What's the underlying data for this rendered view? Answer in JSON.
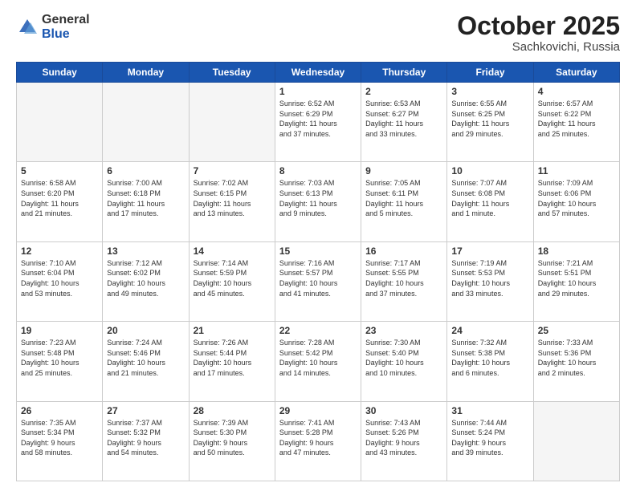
{
  "header": {
    "logo_general": "General",
    "logo_blue": "Blue",
    "month_title": "October 2025",
    "location": "Sachkovichi, Russia"
  },
  "days_of_week": [
    "Sunday",
    "Monday",
    "Tuesday",
    "Wednesday",
    "Thursday",
    "Friday",
    "Saturday"
  ],
  "weeks": [
    [
      {
        "day": "",
        "info": ""
      },
      {
        "day": "",
        "info": ""
      },
      {
        "day": "",
        "info": ""
      },
      {
        "day": "1",
        "info": "Sunrise: 6:52 AM\nSunset: 6:29 PM\nDaylight: 11 hours\nand 37 minutes."
      },
      {
        "day": "2",
        "info": "Sunrise: 6:53 AM\nSunset: 6:27 PM\nDaylight: 11 hours\nand 33 minutes."
      },
      {
        "day": "3",
        "info": "Sunrise: 6:55 AM\nSunset: 6:25 PM\nDaylight: 11 hours\nand 29 minutes."
      },
      {
        "day": "4",
        "info": "Sunrise: 6:57 AM\nSunset: 6:22 PM\nDaylight: 11 hours\nand 25 minutes."
      }
    ],
    [
      {
        "day": "5",
        "info": "Sunrise: 6:58 AM\nSunset: 6:20 PM\nDaylight: 11 hours\nand 21 minutes."
      },
      {
        "day": "6",
        "info": "Sunrise: 7:00 AM\nSunset: 6:18 PM\nDaylight: 11 hours\nand 17 minutes."
      },
      {
        "day": "7",
        "info": "Sunrise: 7:02 AM\nSunset: 6:15 PM\nDaylight: 11 hours\nand 13 minutes."
      },
      {
        "day": "8",
        "info": "Sunrise: 7:03 AM\nSunset: 6:13 PM\nDaylight: 11 hours\nand 9 minutes."
      },
      {
        "day": "9",
        "info": "Sunrise: 7:05 AM\nSunset: 6:11 PM\nDaylight: 11 hours\nand 5 minutes."
      },
      {
        "day": "10",
        "info": "Sunrise: 7:07 AM\nSunset: 6:08 PM\nDaylight: 11 hours\nand 1 minute."
      },
      {
        "day": "11",
        "info": "Sunrise: 7:09 AM\nSunset: 6:06 PM\nDaylight: 10 hours\nand 57 minutes."
      }
    ],
    [
      {
        "day": "12",
        "info": "Sunrise: 7:10 AM\nSunset: 6:04 PM\nDaylight: 10 hours\nand 53 minutes."
      },
      {
        "day": "13",
        "info": "Sunrise: 7:12 AM\nSunset: 6:02 PM\nDaylight: 10 hours\nand 49 minutes."
      },
      {
        "day": "14",
        "info": "Sunrise: 7:14 AM\nSunset: 5:59 PM\nDaylight: 10 hours\nand 45 minutes."
      },
      {
        "day": "15",
        "info": "Sunrise: 7:16 AM\nSunset: 5:57 PM\nDaylight: 10 hours\nand 41 minutes."
      },
      {
        "day": "16",
        "info": "Sunrise: 7:17 AM\nSunset: 5:55 PM\nDaylight: 10 hours\nand 37 minutes."
      },
      {
        "day": "17",
        "info": "Sunrise: 7:19 AM\nSunset: 5:53 PM\nDaylight: 10 hours\nand 33 minutes."
      },
      {
        "day": "18",
        "info": "Sunrise: 7:21 AM\nSunset: 5:51 PM\nDaylight: 10 hours\nand 29 minutes."
      }
    ],
    [
      {
        "day": "19",
        "info": "Sunrise: 7:23 AM\nSunset: 5:48 PM\nDaylight: 10 hours\nand 25 minutes."
      },
      {
        "day": "20",
        "info": "Sunrise: 7:24 AM\nSunset: 5:46 PM\nDaylight: 10 hours\nand 21 minutes."
      },
      {
        "day": "21",
        "info": "Sunrise: 7:26 AM\nSunset: 5:44 PM\nDaylight: 10 hours\nand 17 minutes."
      },
      {
        "day": "22",
        "info": "Sunrise: 7:28 AM\nSunset: 5:42 PM\nDaylight: 10 hours\nand 14 minutes."
      },
      {
        "day": "23",
        "info": "Sunrise: 7:30 AM\nSunset: 5:40 PM\nDaylight: 10 hours\nand 10 minutes."
      },
      {
        "day": "24",
        "info": "Sunrise: 7:32 AM\nSunset: 5:38 PM\nDaylight: 10 hours\nand 6 minutes."
      },
      {
        "day": "25",
        "info": "Sunrise: 7:33 AM\nSunset: 5:36 PM\nDaylight: 10 hours\nand 2 minutes."
      }
    ],
    [
      {
        "day": "26",
        "info": "Sunrise: 7:35 AM\nSunset: 5:34 PM\nDaylight: 9 hours\nand 58 minutes."
      },
      {
        "day": "27",
        "info": "Sunrise: 7:37 AM\nSunset: 5:32 PM\nDaylight: 9 hours\nand 54 minutes."
      },
      {
        "day": "28",
        "info": "Sunrise: 7:39 AM\nSunset: 5:30 PM\nDaylight: 9 hours\nand 50 minutes."
      },
      {
        "day": "29",
        "info": "Sunrise: 7:41 AM\nSunset: 5:28 PM\nDaylight: 9 hours\nand 47 minutes."
      },
      {
        "day": "30",
        "info": "Sunrise: 7:43 AM\nSunset: 5:26 PM\nDaylight: 9 hours\nand 43 minutes."
      },
      {
        "day": "31",
        "info": "Sunrise: 7:44 AM\nSunset: 5:24 PM\nDaylight: 9 hours\nand 39 minutes."
      },
      {
        "day": "",
        "info": ""
      }
    ]
  ]
}
